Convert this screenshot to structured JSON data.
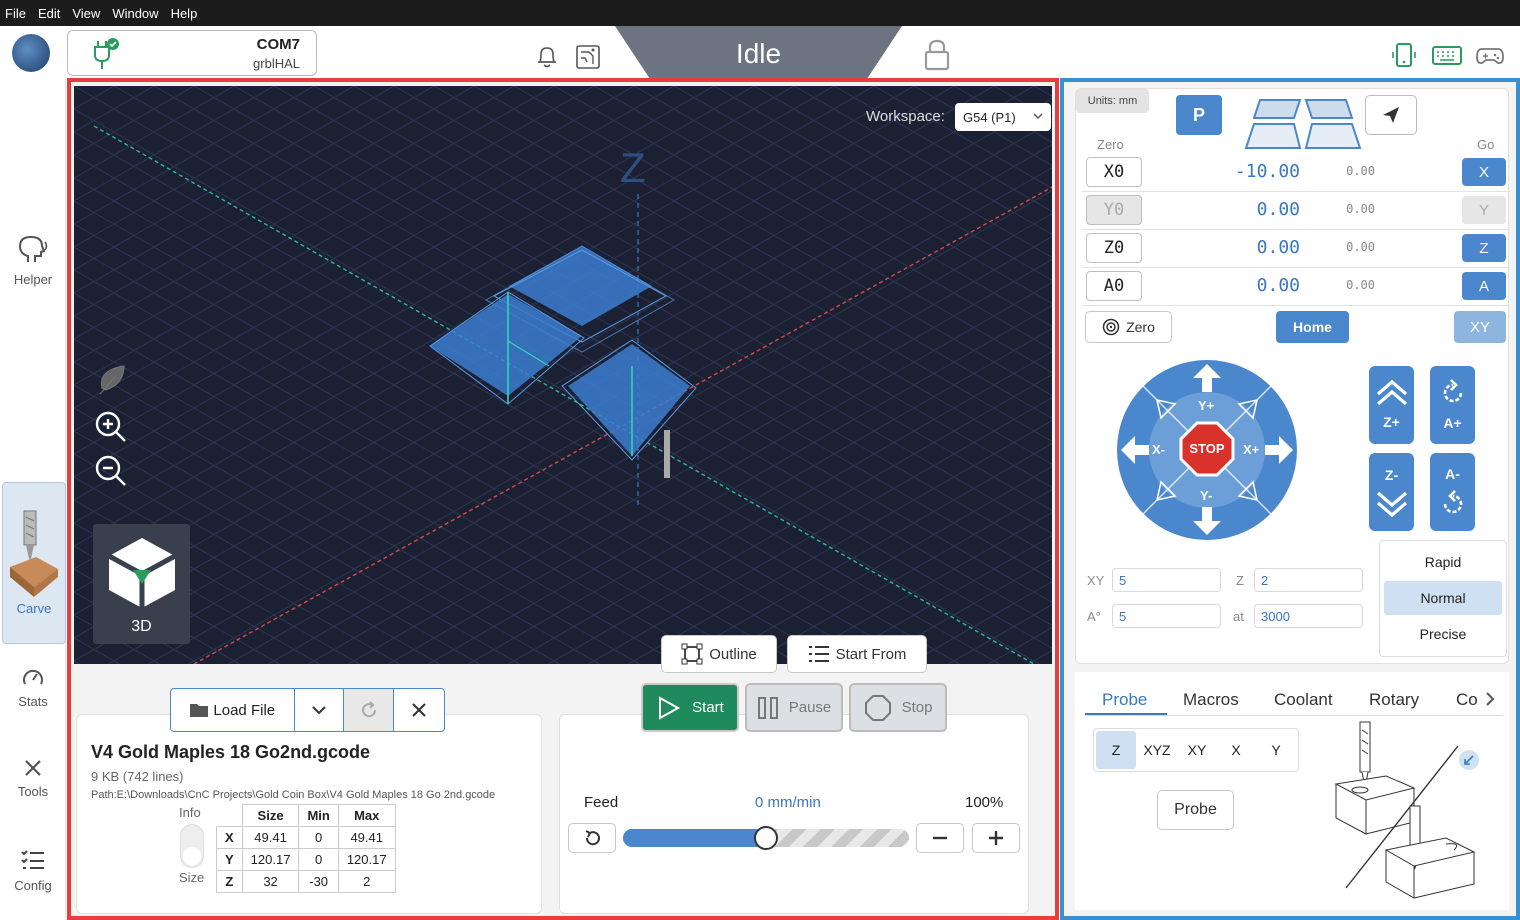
{
  "menu": [
    "File",
    "Edit",
    "View",
    "Window",
    "Help"
  ],
  "connection": {
    "port": "COM7",
    "firmware": "grblHAL"
  },
  "status": {
    "state": "Idle"
  },
  "nav": [
    {
      "label": "Helper",
      "icon": "helper-icon"
    },
    {
      "label": "Carve",
      "icon": "carve-icon"
    },
    {
      "label": "Stats",
      "icon": "stats-icon"
    },
    {
      "label": "Tools",
      "icon": "tools-icon"
    },
    {
      "label": "Config",
      "icon": "config-icon"
    }
  ],
  "visualizer": {
    "workspace_label": "Workspace:",
    "workspace_value": "G54 (P1)",
    "z_axis_label": "Z",
    "view_label": "3D"
  },
  "job_buttons": {
    "outline": "Outline",
    "start_from": "Start From",
    "start": "Start",
    "pause": "Pause",
    "stop": "Stop",
    "load_file": "Load File"
  },
  "file": {
    "name": "V4 Gold Maples 18 Go2nd.gcode",
    "meta": "9 KB (742 lines)",
    "path": "Path:E:\\Downloads\\CnC Projects\\Gold Coin Box\\V4 Gold Maples 18 Go 2nd.gcode",
    "toggle_top": "Info",
    "toggle_bottom": "Size",
    "headers": [
      "",
      "Size",
      "Min",
      "Max"
    ],
    "rows": [
      [
        "X",
        "49.41",
        "0",
        "49.41"
      ],
      [
        "Y",
        "120.17",
        "0",
        "120.17"
      ],
      [
        "Z",
        "32",
        "-30",
        "2"
      ]
    ]
  },
  "feed": {
    "label": "Feed",
    "rate": "0 mm/min",
    "percent": "100%",
    "slider_fraction": 0.5
  },
  "units": "Units: mm",
  "dro": {
    "zero_header": "Zero",
    "go_header": "Go",
    "rows": [
      {
        "axis": "X0",
        "value": "-10.00",
        "machine": "0.00",
        "go": "X"
      },
      {
        "axis": "Y0",
        "value": "0.00",
        "machine": "0.00",
        "go": "Y"
      },
      {
        "axis": "Z0",
        "value": "0.00",
        "machine": "0.00",
        "go": "Z"
      },
      {
        "axis": "A0",
        "value": "0.00",
        "machine": "0.00",
        "go": "A"
      }
    ],
    "zero_btn": "Zero",
    "home_btn": "Home",
    "xy_btn": "XY",
    "p_btn": "P"
  },
  "jog": {
    "y_plus": "Y+",
    "y_minus": "Y-",
    "x_plus": "X+",
    "x_minus": "X-",
    "stop": "STOP",
    "z_plus": "Z+",
    "z_minus": "Z-",
    "a_plus": "A+",
    "a_minus": "A-"
  },
  "jog_settings": {
    "xy_label": "XY",
    "xy_value": "5",
    "z_label": "Z",
    "z_value": "2",
    "a_label": "A°",
    "a_value": "5",
    "at_label": "at",
    "at_value": "3000"
  },
  "speed_modes": [
    "Rapid",
    "Normal",
    "Precise"
  ],
  "tabs": [
    "Probe",
    "Macros",
    "Coolant",
    "Rotary",
    "Co"
  ],
  "probe": {
    "axes": [
      "Z",
      "XYZ",
      "XY",
      "X",
      "Y"
    ],
    "probe_btn": "Probe"
  },
  "colors": {
    "accent": "#4a87cc",
    "start_green": "#1f8a5b",
    "stop_red": "#d9312b",
    "frame_red": "#e93c3c",
    "frame_blue": "#3a8fd0"
  }
}
